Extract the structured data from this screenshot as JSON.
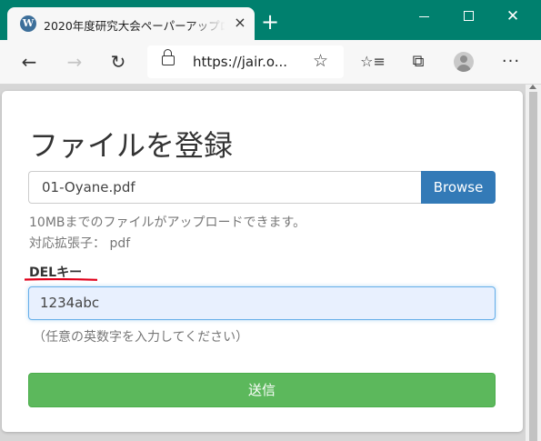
{
  "browser": {
    "tab_title": "2020年度研究大会ペーパーアップロード",
    "tab_favicon": "W",
    "new_tab_icon": "+",
    "close_tab_icon": "×",
    "url": "https://jair.o...",
    "window_close_icon": "✕"
  },
  "toolbar": {
    "back_icon": "←",
    "forward_icon": "→",
    "refresh_icon": "↻",
    "star_icon": "☆",
    "favorites_icon": "☆≡",
    "collections_icon": "⧉",
    "menu_icon": "···"
  },
  "form": {
    "title": "ファイルを登録",
    "file_name": "01-Oyane.pdf",
    "browse_label": "Browse",
    "help_size": "10MBまでのファイルがアップロードできます。",
    "help_ext": "対応拡張子： pdf",
    "del_label": "DELキー",
    "del_value": "1234abc",
    "del_hint": "（任意の英数字を入力してください）",
    "submit_label": "送信"
  },
  "colors": {
    "titlebar": "#00806e",
    "browse_button": "#337ab7",
    "submit_button": "#5cb85c",
    "annotation_underline": "#e0001a"
  }
}
